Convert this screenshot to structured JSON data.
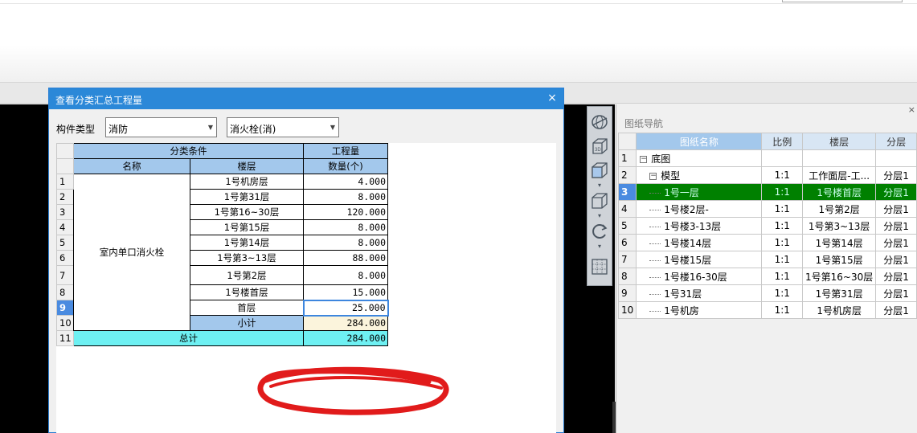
{
  "dialog": {
    "title": "查看分类汇总工程量",
    "close_glyph": "×",
    "type_label": "构件类型",
    "type_value": "消防",
    "subtype_value": "消火栓(消)",
    "table": {
      "group_header": "分类条件",
      "qty_group_header": "工程量",
      "col_name": "名称",
      "col_floor": "楼层",
      "col_qty": "数量(个)",
      "item_name": "室内单口消火栓",
      "rows": [
        {
          "n": "1",
          "floor": "1号机房层",
          "qty": "4.000"
        },
        {
          "n": "2",
          "floor": "1号第31层",
          "qty": "8.000"
        },
        {
          "n": "3",
          "floor": "1号第16~30层",
          "qty": "120.000"
        },
        {
          "n": "4",
          "floor": "1号第15层",
          "qty": "8.000"
        },
        {
          "n": "5",
          "floor": "1号第14层",
          "qty": "8.000"
        },
        {
          "n": "6",
          "floor": "1号第3~13层",
          "qty": "88.000"
        },
        {
          "n": "7",
          "floor": "1号第2层",
          "qty": "8.000"
        },
        {
          "n": "8",
          "floor": "1号楼首层",
          "qty": "15.000"
        },
        {
          "n": "9",
          "floor": "首层",
          "qty": "25.000"
        }
      ],
      "subtotal_n": "10",
      "subtotal_label": "小计",
      "subtotal_qty": "284.000",
      "total_n": "11",
      "total_label": "总计",
      "total_qty": "284.000"
    }
  },
  "navigator": {
    "title": "图纸导航",
    "close_glyph": "×",
    "headers": [
      "图纸名称",
      "比例",
      "楼层",
      "分层"
    ],
    "rows": [
      {
        "n": "1",
        "name": "底图",
        "scale": "",
        "floor": "",
        "layer": "",
        "tree": "minus",
        "indent": 0
      },
      {
        "n": "2",
        "name": "模型",
        "scale": "1:1",
        "floor": "工作面层-工...",
        "layer": "分层1",
        "tree": "minus",
        "indent": 1
      },
      {
        "n": "3",
        "name": "1号一层",
        "scale": "1:1",
        "floor": "1号楼首层",
        "layer": "分层1",
        "tree": "dots",
        "indent": 1,
        "selected": true
      },
      {
        "n": "4",
        "name": "1号楼2层-",
        "scale": "1:1",
        "floor": "1号第2层",
        "layer": "分层1",
        "tree": "dots",
        "indent": 1
      },
      {
        "n": "5",
        "name": "1号楼3-13层",
        "scale": "1:1",
        "floor": "1号第3~13层",
        "layer": "分层1",
        "tree": "dots",
        "indent": 1
      },
      {
        "n": "6",
        "name": "1号楼14层",
        "scale": "1:1",
        "floor": "1号第14层",
        "layer": "分层1",
        "tree": "dots",
        "indent": 1
      },
      {
        "n": "7",
        "name": "1号楼15层",
        "scale": "1:1",
        "floor": "1号第15层",
        "layer": "分层1",
        "tree": "dots",
        "indent": 1
      },
      {
        "n": "8",
        "name": "1号楼16-30层",
        "scale": "1:1",
        "floor": "1号第16~30层",
        "layer": "分层1",
        "tree": "dots",
        "indent": 1
      },
      {
        "n": "9",
        "name": "1号31层",
        "scale": "1:1",
        "floor": "1号第31层",
        "layer": "分层1",
        "tree": "dots",
        "indent": 1
      },
      {
        "n": "10",
        "name": "1号机房",
        "scale": "1:1",
        "floor": "1号机房层",
        "layer": "分层1",
        "tree": "dots",
        "indent": 1
      }
    ]
  },
  "toolstrip": {
    "tools": [
      "globe-icon",
      "view-3d-icon",
      "cube-front-icon",
      "cube-icon",
      "rotate-icon",
      "grid-settings-icon"
    ],
    "label_3d": "3D"
  },
  "colors": {
    "title_bar": "#2b88d8",
    "header_blue": "#a3c8ec",
    "total_cyan": "#6ef0f2",
    "nav_selected": "#008000",
    "annotation_red": "#e11b1b"
  }
}
